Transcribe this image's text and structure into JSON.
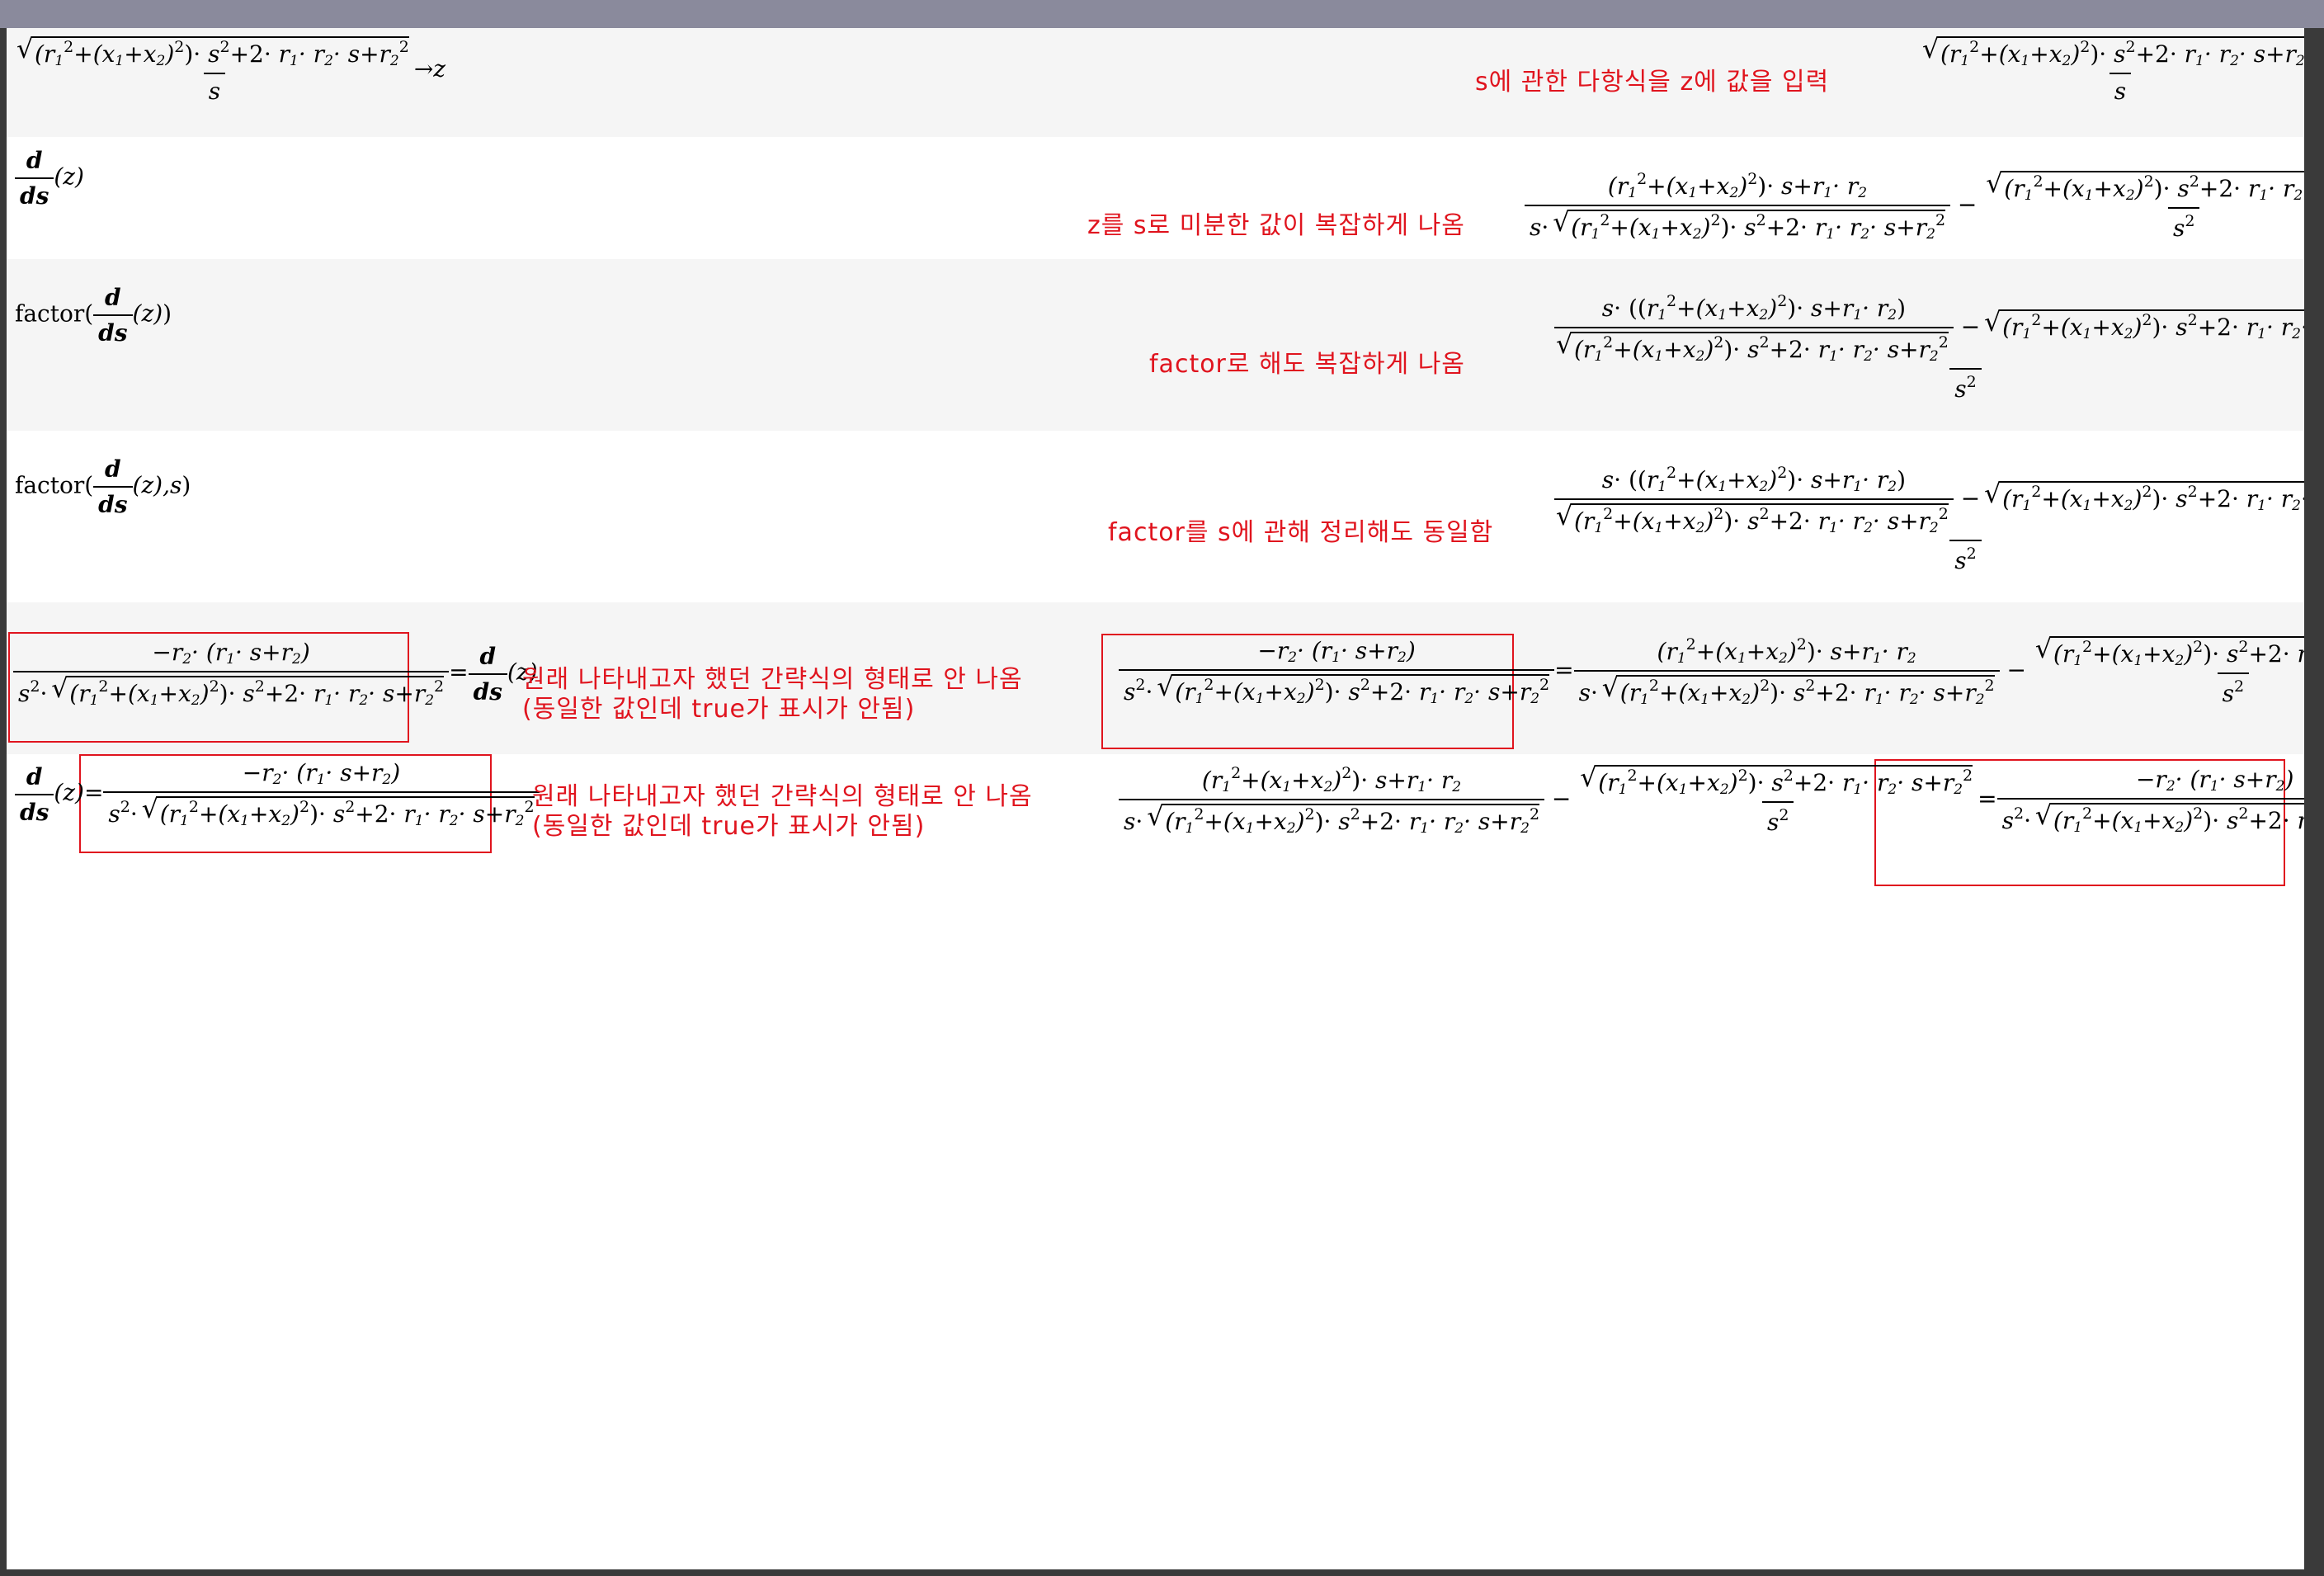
{
  "window": {
    "title": ""
  },
  "worksheet": {
    "notes": {
      "n1": "s에 관한 다항식을 z에 값을 입력",
      "n2": "z를 s로 미분한 값이 복잡하게 나옴",
      "n3": "factor로 해도 복잡하게 나옴",
      "n4": "factor를 s에 관해 정리해도 동일함",
      "n5a": "원래 나타내고자 했던 간략식의 형태로 안 나옴",
      "n5b": "(동일한 값인데 true가 표시가 안됨)",
      "n6a": "원래 나타내고자 했던 간략식의 형태로 안 나옴",
      "n6b": "(동일한 값인데 true가 표시가 안됨)"
    },
    "math": {
      "arrow_z": "→z",
      "factor": "factor",
      "d": "d",
      "ds": "ds",
      "z_paren": "(z)",
      "z_paren_s": "(z),s",
      "eq": "=",
      "minus": "−",
      "s": "s",
      "s2": "s",
      "exp2": "2"
    }
  },
  "colors": {
    "annotation_red": "#e0141e",
    "titlebar": "#8a8a9c",
    "row_shade": "#f5f5f5"
  }
}
